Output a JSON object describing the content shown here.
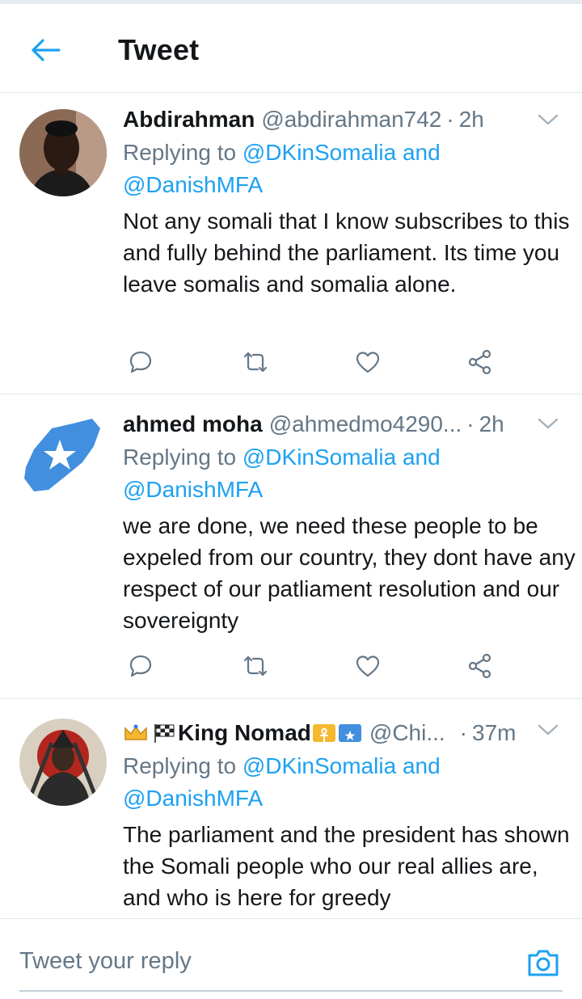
{
  "header": {
    "title": "Tweet"
  },
  "tweets": [
    {
      "display_name": "Abdirahman",
      "handle": "@abdirahman742",
      "time": "2h",
      "separator": "·",
      "replying_prefix": "Replying to",
      "reply_mention_1": "@DKinSomalia",
      "reply_and": "and",
      "reply_mention_2": "@DanishMFA",
      "text": "Not any somali that I know subscribes to this and fully behind the parliament. Its time you leave somalis and somalia alone."
    },
    {
      "display_name": "ahmed moha",
      "handle": "@ahmedmo4290...",
      "time": "2h",
      "separator": "·",
      "replying_prefix": "Replying to",
      "reply_mention_1": "@DKinSomalia",
      "reply_and": "and",
      "reply_mention_2": "@DanishMFA",
      "text": "we are done, we need these people to be expeled from our country, they dont have any respect of our patliament resolution and our sovereignty"
    },
    {
      "display_name": "King Nomad",
      "handle": "@Chi...",
      "time": "37m",
      "separator": "·",
      "replying_prefix": "Replying to",
      "reply_mention_1": "@DKinSomalia",
      "reply_and": "and",
      "reply_mention_2": "@DanishMFA",
      "text": "The parliament and the president has shown the Somali people who our real allies are, and who is here for greedy"
    }
  ],
  "reply_bar": {
    "placeholder": "Tweet your reply"
  },
  "colors": {
    "accent": "#1da1f2",
    "text": "#14171a",
    "secondary": "#657786",
    "border": "#e1e8ed"
  }
}
